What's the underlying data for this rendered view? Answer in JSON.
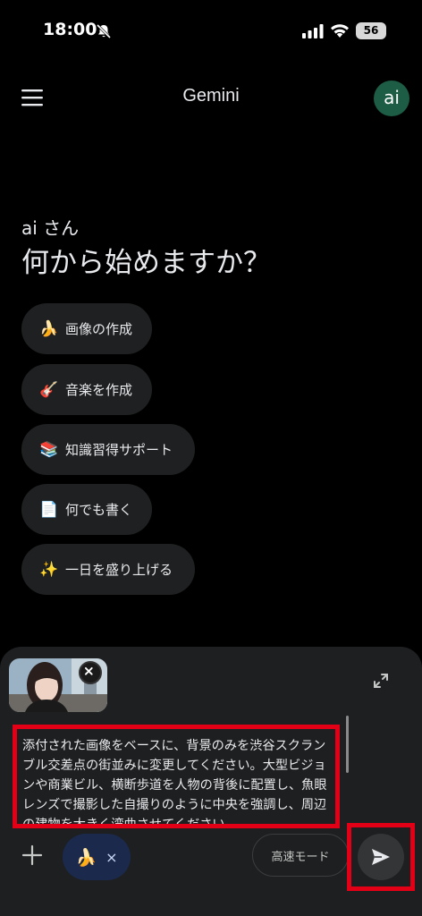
{
  "status_bar": {
    "time": "18:00",
    "battery": "56"
  },
  "header": {
    "title": "Gemini",
    "avatar_initials": "ai"
  },
  "greeting": {
    "name": "ai さん",
    "question": "何から始めますか？"
  },
  "suggestions": [
    {
      "icon": "banana-icon",
      "emoji": "🍌",
      "label": "画像の作成"
    },
    {
      "icon": "guitar-icon",
      "emoji": "🎸",
      "label": "音楽を作成"
    },
    {
      "icon": "books-icon",
      "emoji": "📚",
      "label": "知識習得サポート"
    },
    {
      "icon": "document-icon",
      "emoji": "📄",
      "label": "何でも書く"
    },
    {
      "icon": "sparkles-icon",
      "emoji": "✨",
      "label": "一日を盛り上げる"
    }
  ],
  "composer": {
    "prompt_text": "添付された画像をベースに、背景のみを渋谷スクランブル交差点の街並みに変更してください。大型ビジョンや商業ビル、横断歩道を人物の背後に配置し、魚眼レンズで撮影した自撮りのように中央を強調し、周辺の建物を大きく湾曲させてください。",
    "tool_chip_emoji": "🍌",
    "tool_chip_close": "×",
    "mode_label": "高速モード"
  },
  "colors": {
    "background": "#000000",
    "chip": "#1f2021",
    "composer": "#1e1f20",
    "avatar": "#1d5c45",
    "highlight": "#e30016",
    "tool_chip": "#1b2a4c"
  }
}
